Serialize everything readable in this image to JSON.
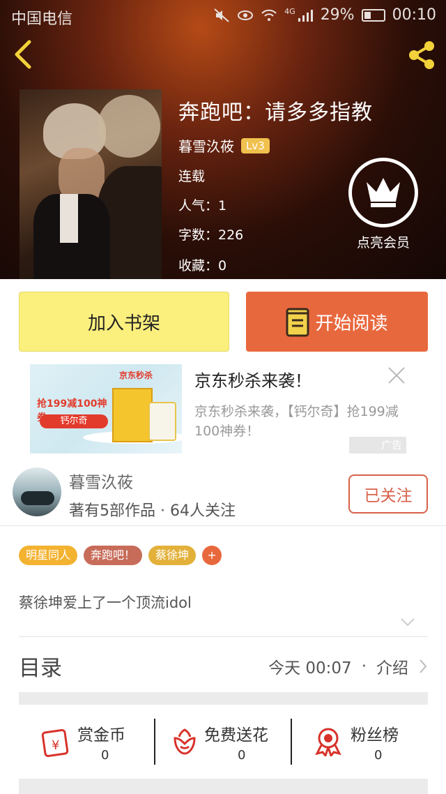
{
  "status_bar": {
    "carrier": "中国电信",
    "battery": "29%",
    "time": "00:10",
    "network": "4G"
  },
  "book": {
    "title": "奔跑吧：请多多指教",
    "author": "暮雪汣莜",
    "level": "Lv3",
    "status": "连载",
    "popularity": "人气：1",
    "word_count": "字数：226",
    "favorites": "收藏：0",
    "member_label": "点亮会员"
  },
  "buttons": {
    "shelf": "加入书架",
    "read": "开始阅读"
  },
  "ad": {
    "title": "京东秒杀来袭！",
    "description": "京东秒杀来袭，【钙尔奇】抢199减100神券！",
    "label": "广告",
    "coupon_text": "抢199减100神券",
    "pill_text": "钙尔奇",
    "brand_tag": "京东秒杀"
  },
  "author_profile": {
    "name": "暮雪汣莜",
    "stats": "著有5部作品 · 64人关注",
    "follow_label": "已关注"
  },
  "tags": [
    "明星同人",
    "奔跑吧！",
    "蔡徐坤",
    "+"
  ],
  "description": "蔡徐坤爱上了一个顶流idol",
  "toc": {
    "label": "目录",
    "updated": "今天 00:07",
    "separator": "·",
    "intro": "介绍"
  },
  "actions": [
    {
      "label": "赏金币",
      "value": "0",
      "icon": "reward-envelope-icon"
    },
    {
      "label": "免费送花",
      "value": "0",
      "icon": "flower-icon"
    },
    {
      "label": "粉丝榜",
      "value": "0",
      "icon": "medal-icon"
    }
  ],
  "colors": {
    "accent": "#e8683d",
    "shelf": "#fbef7e",
    "follow": "#d8614a",
    "icon_red": "#d7332b"
  }
}
